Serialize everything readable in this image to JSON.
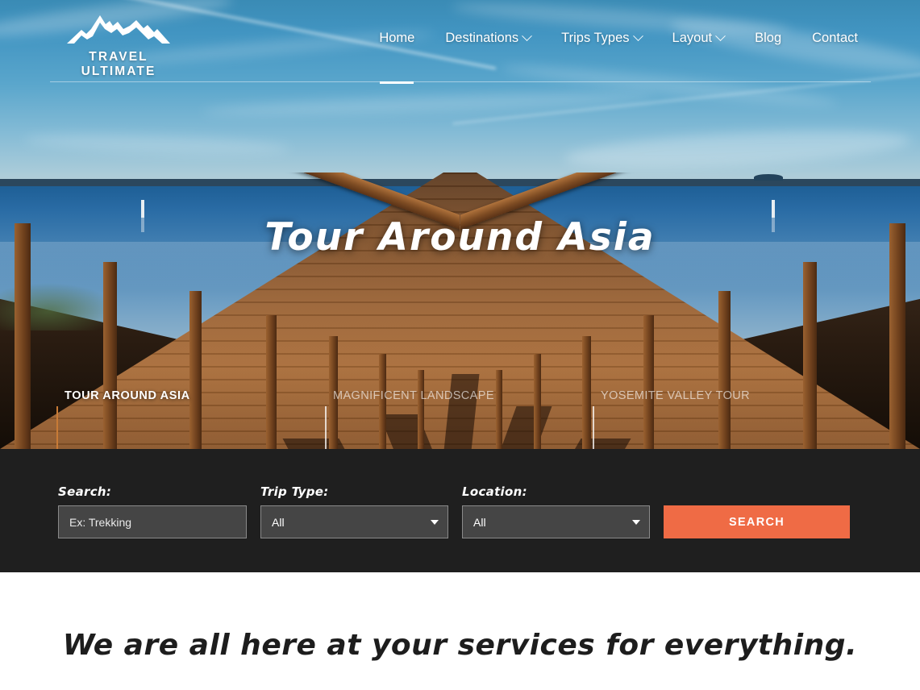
{
  "brand": {
    "name": "TRAVEL ULTIMATE",
    "logo_icon": "mountain-range-icon"
  },
  "nav": {
    "items": [
      {
        "label": "Home",
        "has_dropdown": false,
        "active": true
      },
      {
        "label": "Destinations",
        "has_dropdown": true,
        "active": false
      },
      {
        "label": "Trips Types",
        "has_dropdown": true,
        "active": false
      },
      {
        "label": "Layout",
        "has_dropdown": true,
        "active": false
      },
      {
        "label": "Blog",
        "has_dropdown": false,
        "active": false
      },
      {
        "label": "Contact",
        "has_dropdown": false,
        "active": false
      }
    ]
  },
  "hero": {
    "title": "Tour Around Asia",
    "slides": [
      {
        "label": "TOUR AROUND ASIA",
        "active": true
      },
      {
        "label": "MAGNIFICENT LANDSCAPE",
        "active": false
      },
      {
        "label": "YOSEMITE VALLEY TOUR",
        "active": false
      }
    ]
  },
  "search": {
    "search_label": "Search:",
    "search_placeholder": "Ex: Trekking",
    "trip_type_label": "Trip Type:",
    "trip_type_value": "All",
    "location_label": "Location:",
    "location_value": "All",
    "button_label": "SEARCH"
  },
  "content": {
    "heading": "We are all here at your services for everything."
  },
  "colors": {
    "accent": "#ef6b45",
    "searchbar_bg": "#1f1f1f",
    "active_tab_bar": "#c87b36"
  }
}
